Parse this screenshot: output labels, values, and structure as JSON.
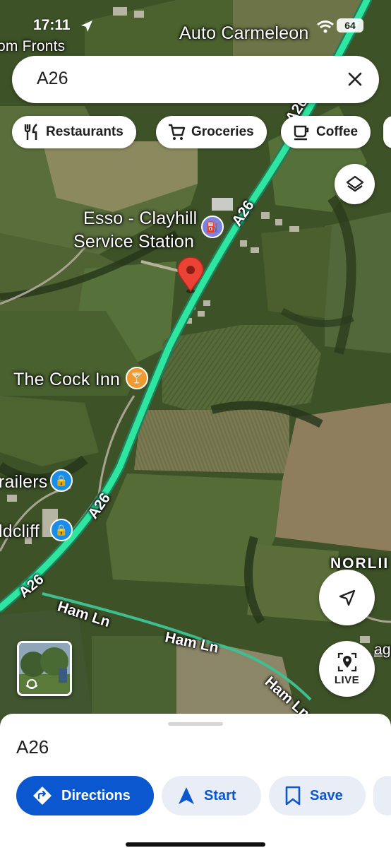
{
  "status_bar": {
    "time": "17:11",
    "battery": "64"
  },
  "search": {
    "query": "A26"
  },
  "chips": [
    {
      "label": "Restaurants",
      "icon": "fork-knife-icon"
    },
    {
      "label": "Groceries",
      "icon": "cart-icon"
    },
    {
      "label": "Coffee",
      "icon": "coffee-cup-icon"
    }
  ],
  "map": {
    "labels": {
      "auto_carmeleon": "Auto Carmeleon",
      "om_fronts": "om Fronts",
      "esso_line1": "Esso - Clayhill",
      "esso_line2": "Service Station",
      "cock_inn": "The Cock Inn",
      "trailers": "railers",
      "oldcliff": "ldcliff",
      "norlington": "NORLII",
      "ragm": "agm"
    },
    "roads": {
      "a26_1": "A26",
      "a26_2": "A26",
      "a26_3": "A26",
      "a26_4": "A26",
      "ham_ln_1": "Ham Ln",
      "ham_ln_2": "Ham Ln",
      "ham_ln_3": "Ham Ln"
    },
    "colors": {
      "route": "#2ee6a0",
      "pin": "#ea4335",
      "fuel_poi": "#7b83e0",
      "bar_poi": "#f29a2e",
      "shop_poi": "#1a8de8"
    }
  },
  "controls": {
    "live_label": "LIVE"
  },
  "place_sheet": {
    "title": "A26",
    "actions": {
      "directions": "Directions",
      "start": "Start",
      "save": "Save"
    }
  }
}
